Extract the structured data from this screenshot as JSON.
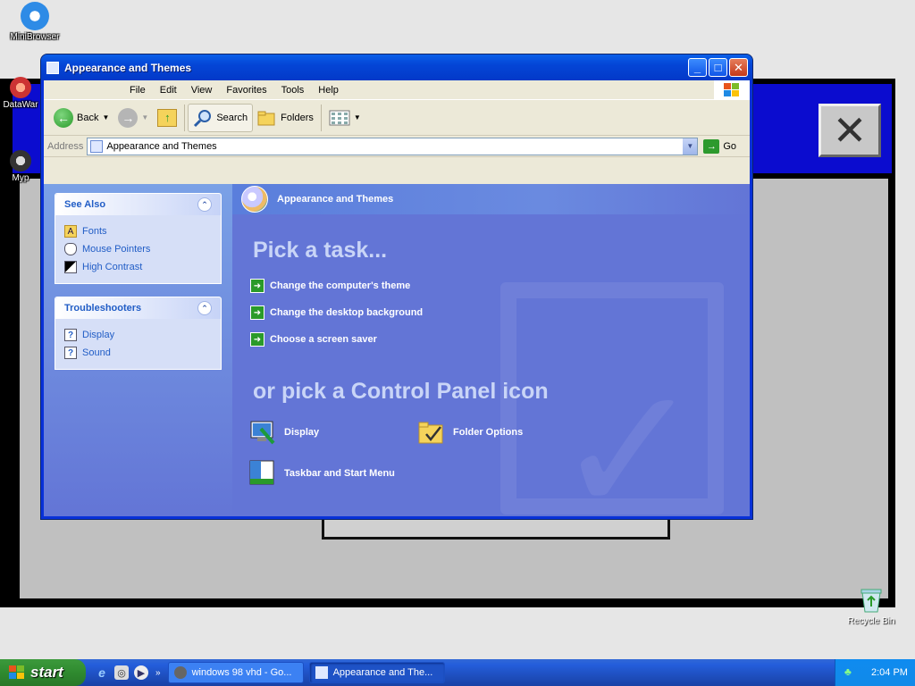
{
  "desktop": {
    "icons": [
      {
        "label": "MiniBrowser"
      },
      {
        "label": "DataWar"
      },
      {
        "label": "Myp"
      }
    ],
    "recycle_bin_label": "Recycle Bin"
  },
  "window": {
    "title": "Appearance and Themes",
    "menu": [
      "File",
      "Edit",
      "View",
      "Favorites",
      "Tools",
      "Help"
    ],
    "toolbar": {
      "back_label": "Back",
      "search_label": "Search",
      "folders_label": "Folders"
    },
    "address": {
      "label": "Address",
      "value": "Appearance and Themes",
      "go_label": "Go"
    },
    "see_also": {
      "title": "See Also",
      "items": [
        {
          "label": "Fonts"
        },
        {
          "label": "Mouse Pointers"
        },
        {
          "label": "High Contrast"
        }
      ]
    },
    "troubleshooters": {
      "title": "Troubleshooters",
      "items": [
        {
          "label": "Display"
        },
        {
          "label": "Sound"
        }
      ]
    },
    "main": {
      "banner": "Appearance and Themes",
      "pick_task_heading": "Pick a task...",
      "tasks": [
        "Change the computer's theme",
        "Change the desktop background",
        "Choose a screen saver"
      ],
      "pick_icon_heading": "or pick a Control Panel icon",
      "icons": [
        {
          "label": "Display"
        },
        {
          "label": "Folder Options"
        },
        {
          "label": "Taskbar and Start Menu"
        }
      ]
    }
  },
  "taskbar": {
    "start_label": "start",
    "tasks": [
      {
        "label": "windows 98 vhd - Go..."
      },
      {
        "label": "Appearance and The..."
      }
    ],
    "clock": "2:04 PM"
  },
  "colors": {
    "xp_blue": "#0831d9",
    "task_pane": "#6375d6",
    "taskbar": "#245edb",
    "start_green": "#2f8a2f"
  }
}
